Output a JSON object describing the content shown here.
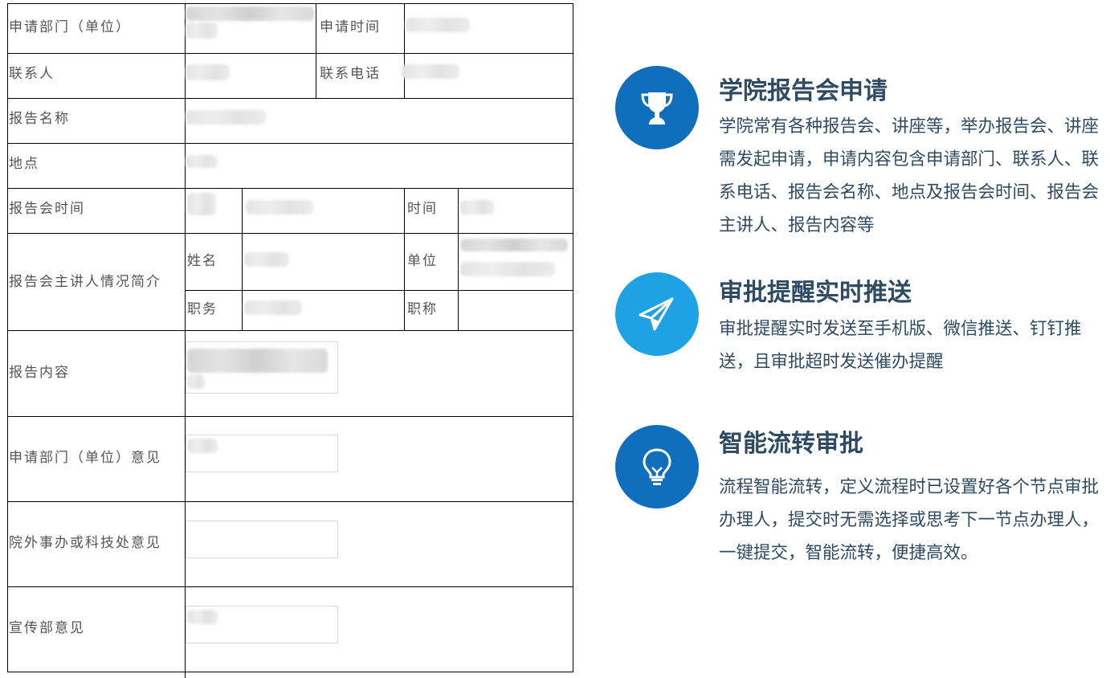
{
  "form": {
    "labels": {
      "apply_dept": "申请部门（单位）",
      "apply_time": "申请时间",
      "contact": "联系人",
      "contact_phone": "联系电话",
      "report_name": "报告名称",
      "location": "地点",
      "report_time": "报告会时间",
      "time": "时间",
      "speaker_intro": "报告会主讲人情况简介",
      "name": "姓名",
      "unit": "单位",
      "duty": "职务",
      "title": "职称",
      "report_content": "报告内容",
      "dept_opinion": "申请部门（单位）意见",
      "office_opinion": "院外事办或科技处意见",
      "publicity_opinion": "宣传部意见"
    }
  },
  "features": [
    {
      "icon": "trophy-icon",
      "color": "#0f6fbd",
      "title": "学院报告会申请",
      "desc": "学院常有各种报告会、讲座等，举办报告会、讲座需发起申请，申请内容包含申请部门、联系人、联系电话、报告会名称、地点及报告会时间、报告会主讲人、报告内容等"
    },
    {
      "icon": "paper-plane-icon",
      "color": "#1fa1e6",
      "title": "审批提醒实时推送",
      "desc": "审批提醒实时发送至手机版、微信推送、钉钉推送，且审批超时发送催办提醒"
    },
    {
      "icon": "lightbulb-icon",
      "color": "#0f6fbd",
      "title": "智能流转审批",
      "desc": "流程智能流转，定义流程时已设置好各个节点审批办理人，提交时无需选择或思考下一节点办理人，一键提交，智能流转，便捷高效。"
    }
  ]
}
